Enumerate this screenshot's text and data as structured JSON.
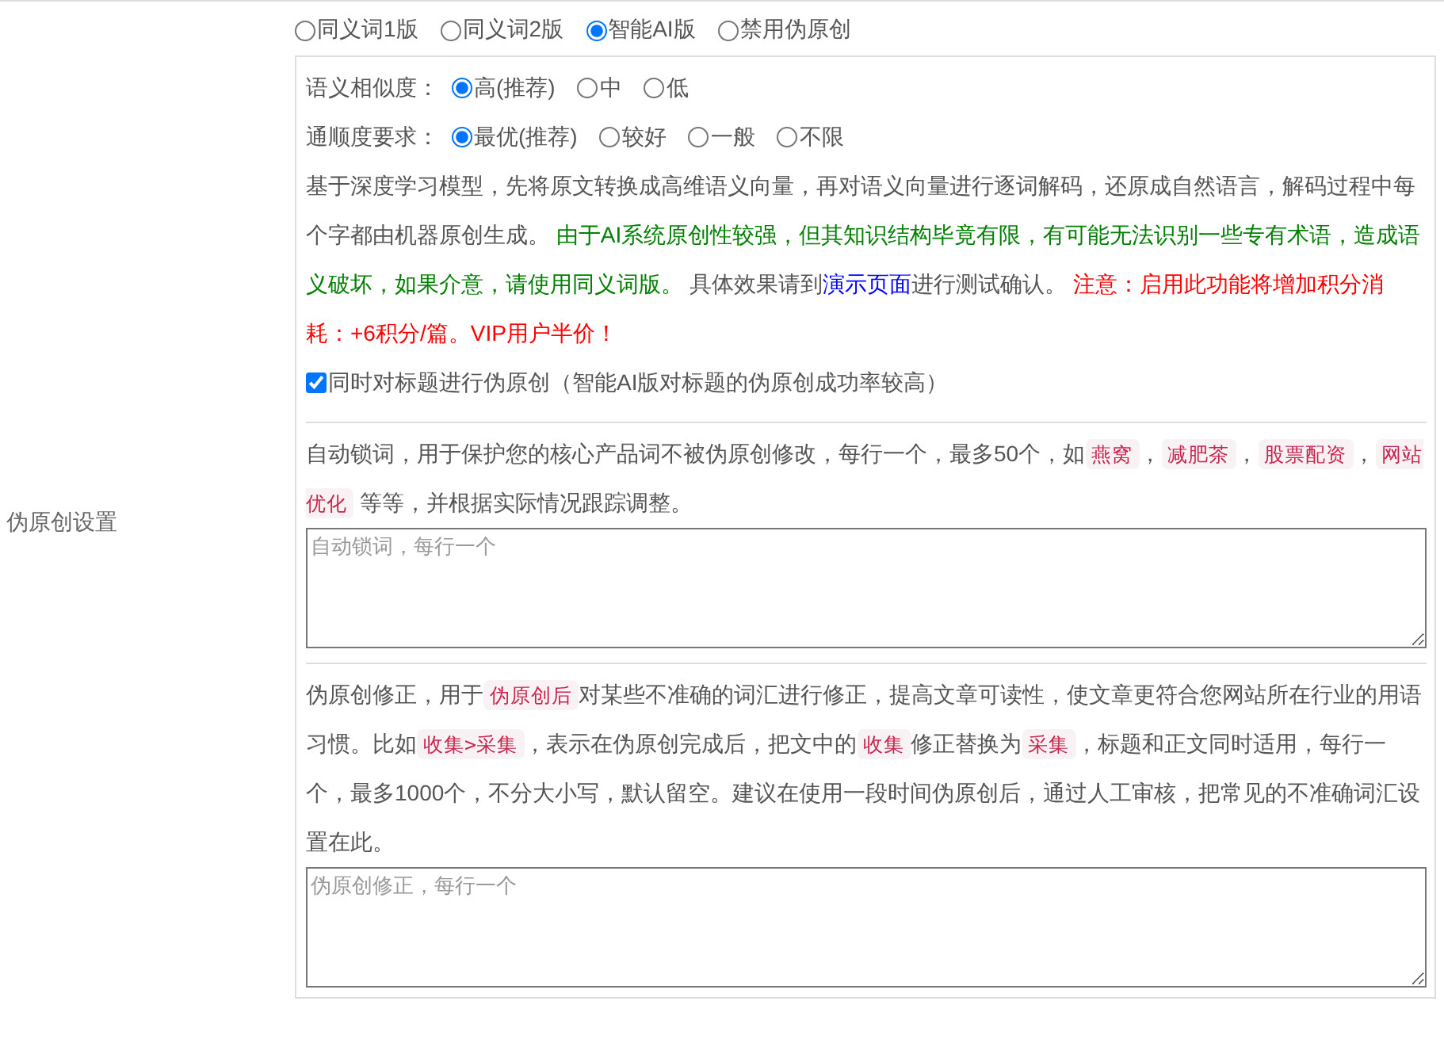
{
  "setting_label": "伪原创设置",
  "modes": [
    {
      "label": "同义词1版",
      "selected": false
    },
    {
      "label": "同义词2版",
      "selected": false
    },
    {
      "label": "智能AI版",
      "selected": true
    },
    {
      "label": "禁用伪原创",
      "selected": false
    }
  ],
  "ai_panel": {
    "option_groups": [
      {
        "label": "语义相似度：",
        "options": [
          {
            "label": "高(推荐)",
            "selected": true
          },
          {
            "label": "中",
            "selected": false
          },
          {
            "label": "低",
            "selected": false
          }
        ]
      },
      {
        "label": "通顺度要求：",
        "options": [
          {
            "label": "最优(推荐)",
            "selected": true
          },
          {
            "label": "较好",
            "selected": false
          },
          {
            "label": "一般",
            "selected": false
          },
          {
            "label": "不限",
            "selected": false
          }
        ]
      }
    ],
    "description": [
      {
        "kind": "text",
        "text": "基于深度学习模型，先将原文转换成高维语义向量，再对语义向量进行逐词解码，还原成自然语言，解码过程中每个字都由机器原创生成。 "
      },
      {
        "kind": "success",
        "text": "由于AI系统原创性较强，但其知识结构毕竟有限，有可能无法识别一些专有术语，造成语义破坏，如果介意，请使用同义词版。"
      },
      {
        "kind": "text",
        "text": " 具体效果请到"
      },
      {
        "kind": "link",
        "text": "演示页面"
      },
      {
        "kind": "text",
        "text": "进行测试确认。 "
      },
      {
        "kind": "warning",
        "text": "注意：启用此功能将增加积分消耗：+6积分/篇。VIP用户半价！"
      }
    ],
    "title_option": {
      "label": "同时对标题进行伪原创（智能AI版对标题的伪原创成功率较高）",
      "checked": true
    }
  },
  "sections": [
    {
      "description": [
        {
          "kind": "text",
          "text": "自动锁词，用于保护您的核心产品词不被伪原创修改，每行一个，最多50个，如"
        },
        {
          "kind": "code",
          "text": "燕窝"
        },
        {
          "kind": "text",
          "text": "，"
        },
        {
          "kind": "code",
          "text": "减肥茶"
        },
        {
          "kind": "text",
          "text": "，"
        },
        {
          "kind": "code",
          "text": "股票配资"
        },
        {
          "kind": "text",
          "text": "，"
        },
        {
          "kind": "code",
          "text": "网站优化"
        },
        {
          "kind": "text",
          "text": " 等等，并根据实际情况跟踪调整。"
        }
      ],
      "placeholder": "自动锁词，每行一个"
    },
    {
      "description": [
        {
          "kind": "text",
          "text": "伪原创修正，用于"
        },
        {
          "kind": "code",
          "text": "伪原创后"
        },
        {
          "kind": "text",
          "text": "对某些不准确的词汇进行修正，提高文章可读性，使文章更符合您网站所在行业的用语习惯。比如"
        },
        {
          "kind": "code",
          "text": "收集>采集"
        },
        {
          "kind": "text",
          "text": "，表示在伪原创完成后，把文中的"
        },
        {
          "kind": "code",
          "text": "收集"
        },
        {
          "kind": "text",
          "text": "修正替换为"
        },
        {
          "kind": "code",
          "text": "采集"
        },
        {
          "kind": "text",
          "text": "，标题和正文同时适用，每行一个，最多1000个，不分大小写，默认留空。建议在使用一段时间伪原创后，通过人工审核，把常见的不准确词汇设置在此。"
        }
      ],
      "placeholder": "伪原创修正，每行一个"
    }
  ]
}
